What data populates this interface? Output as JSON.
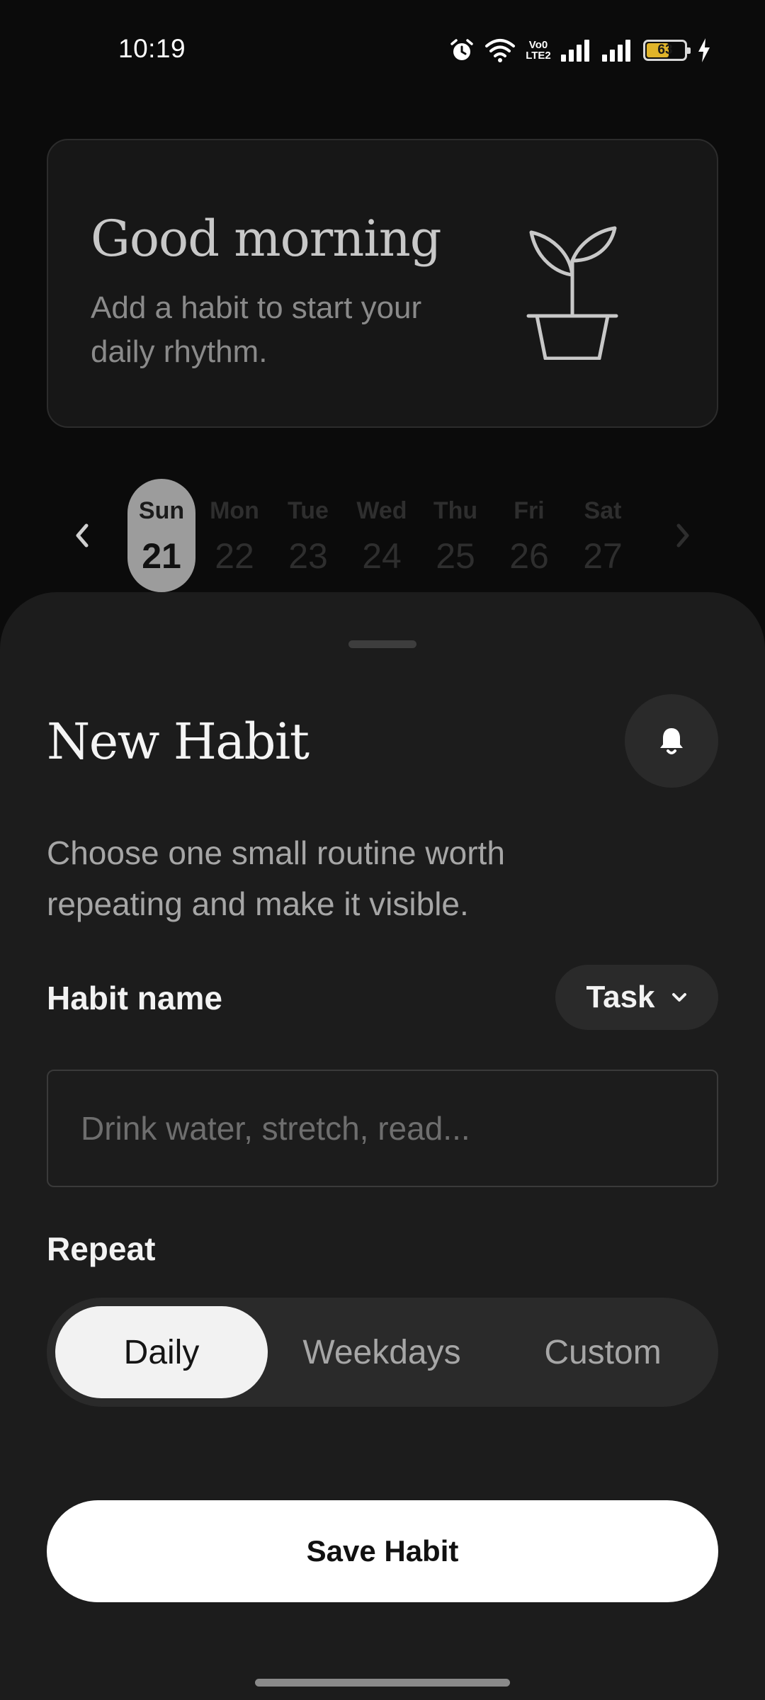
{
  "status_bar": {
    "time": "10:19",
    "volte_top": "Vo0",
    "volte_bottom": "LTE2",
    "battery_percent": 63,
    "battery_text": "63"
  },
  "greeting": {
    "title": "Good morning",
    "subtitle": "Add a habit to start your daily rhythm.",
    "icon": "plant-pot-icon"
  },
  "week": {
    "days": [
      {
        "name": "Sun",
        "num": "21",
        "active": true
      },
      {
        "name": "Mon",
        "num": "22",
        "active": false
      },
      {
        "name": "Tue",
        "num": "23",
        "active": false
      },
      {
        "name": "Wed",
        "num": "24",
        "active": false
      },
      {
        "name": "Thu",
        "num": "25",
        "active": false
      },
      {
        "name": "Fri",
        "num": "26",
        "active": false
      },
      {
        "name": "Sat",
        "num": "27",
        "active": false
      }
    ]
  },
  "sheet": {
    "title": "New Habit",
    "description": "Choose one small routine worth repeating and make it visible.",
    "habit_name_label": "Habit name",
    "type_label": "Task",
    "name_placeholder": "Drink water, stretch, read...",
    "repeat_label": "Repeat",
    "repeat_options": [
      "Daily",
      "Weekdays",
      "Custom"
    ],
    "repeat_selected": "Daily",
    "save_label": "Save Habit"
  },
  "colors": {
    "background": "#0b0b0b",
    "sheet": "#1c1c1c",
    "accent_selected": "#9c9c9c",
    "battery": "#e0b42a"
  }
}
